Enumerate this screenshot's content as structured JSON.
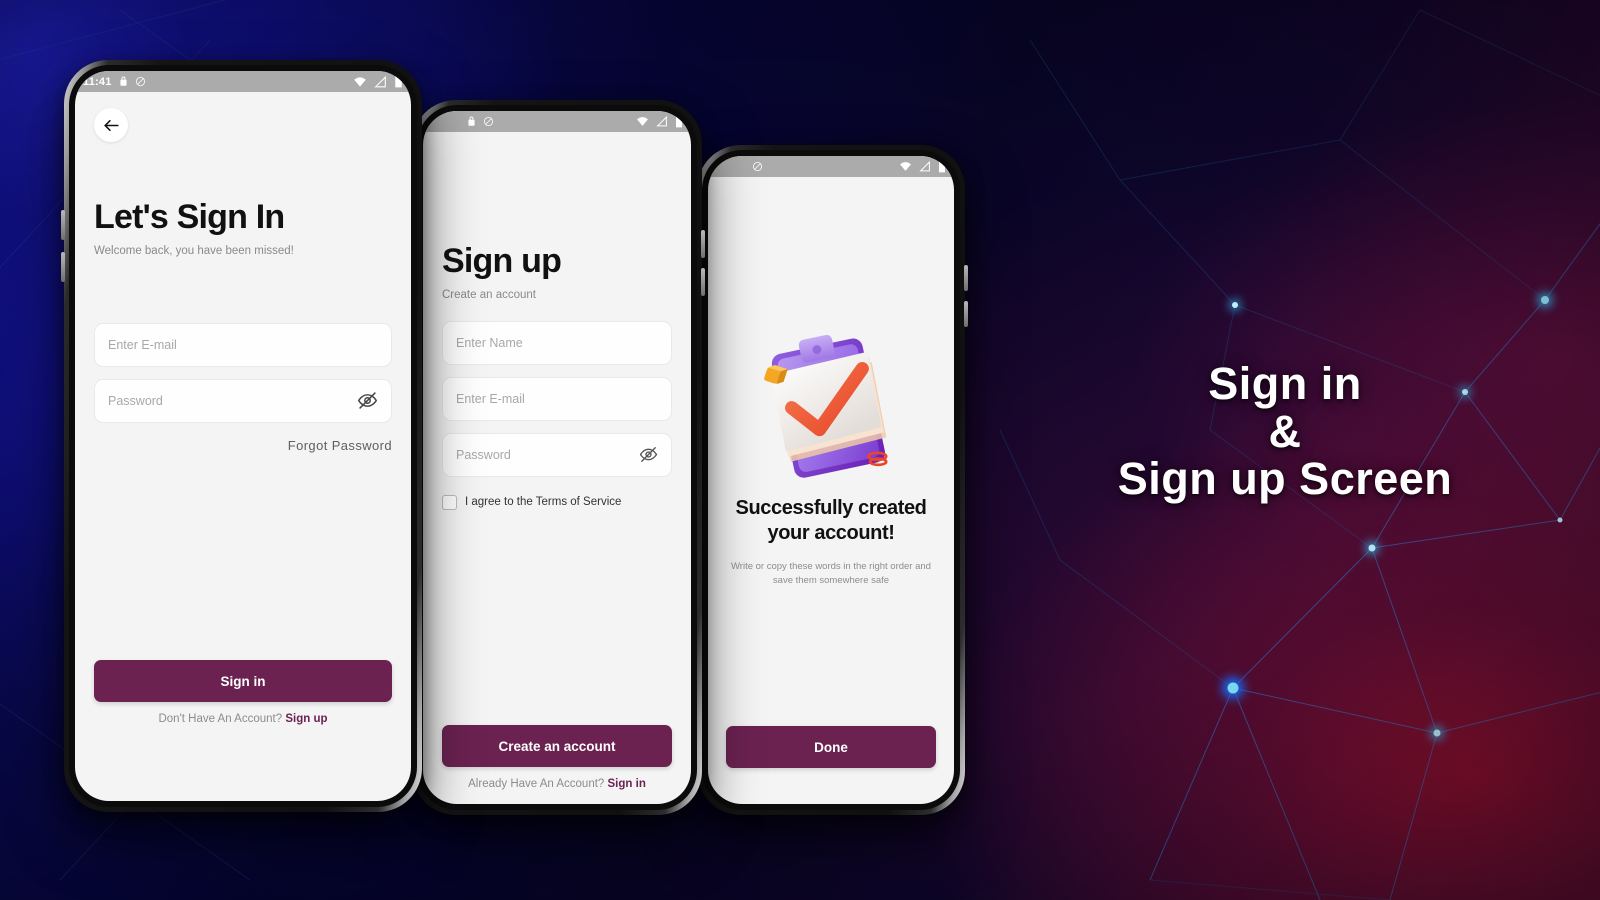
{
  "poster": {
    "title_line1": "Sign in",
    "title_line2": "&",
    "title_line3": "Sign up Screen"
  },
  "colors": {
    "brand_purple": "#6b2251",
    "screen_bg": "#f4f4f4",
    "statusbar": "#ababab",
    "placeholder": "#a8a8a8",
    "node_cyan": "#3fd0ff",
    "bg_blue": "#140f8e",
    "bg_red": "#8b0f2e"
  },
  "status_bar": {
    "time": "11:41",
    "icons": [
      "lock-icon",
      "mute-icon",
      "wifi-icon",
      "signal-icon",
      "battery-icon"
    ]
  },
  "screens": [
    {
      "name": "sign-in",
      "back_icon": "arrow-left-icon",
      "headline": "Let's Sign In",
      "subhead": "Welcome back, you have been missed!",
      "fields": [
        {
          "name": "email",
          "placeholder": "Enter E-mail",
          "value": "",
          "has_eye": false
        },
        {
          "name": "password",
          "placeholder": "Password",
          "value": "",
          "has_eye": true,
          "eye_icon": "eye-off-icon"
        }
      ],
      "forgot_label": "Forgot  Password",
      "cta_label": "Sign in",
      "foot_text": "Don't Have An Account?",
      "foot_link": "Sign up"
    },
    {
      "name": "sign-up",
      "headline": "Sign up",
      "subhead": "Create an account",
      "fields": [
        {
          "name": "full-name",
          "placeholder": "Enter Name",
          "value": "",
          "has_eye": false
        },
        {
          "name": "email",
          "placeholder": "Enter E-mail",
          "value": "",
          "has_eye": false
        },
        {
          "name": "password",
          "placeholder": "Password",
          "value": "",
          "has_eye": true,
          "eye_icon": "eye-off-icon"
        }
      ],
      "terms_label": "I agree to the Terms of Service",
      "cta_label": "Create an account",
      "foot_text": "Already Have An Account?",
      "foot_link": "Sign in"
    },
    {
      "name": "success",
      "illustration": "clipboard-checkmark-illustration",
      "title": "Successfully created your account!",
      "title_line1": "Successfully created",
      "title_line2": "your account!",
      "subtitle": "Write or copy these words in the right order and save them somewhere safe",
      "cta_label": "Done"
    }
  ]
}
